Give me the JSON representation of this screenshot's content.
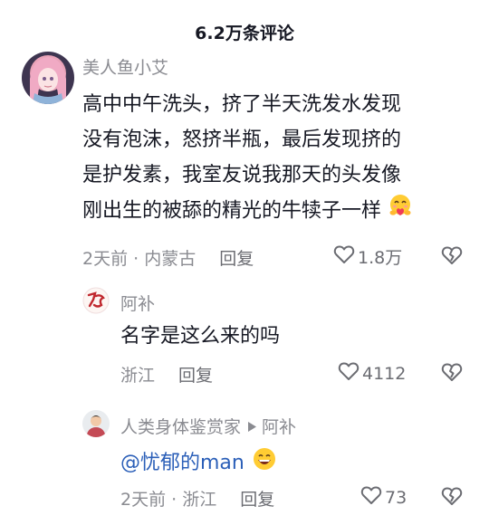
{
  "header": {
    "title": "6.2万条评论"
  },
  "comments": [
    {
      "username": "美人鱼小艾",
      "lines": [
        "高中中午洗头，挤了半天洗发水发现",
        "没有泡沫，怒挤半瓶，最后发现挤的",
        "是护发素，我室友说我那天的头发像",
        "刚出生的被舔的精光的牛犊子一样"
      ],
      "emoji": "heart-hug-emoji",
      "time_location": "2天前 · 内蒙古",
      "reply_label": "回复",
      "likes": "1.8万"
    }
  ],
  "replies": [
    {
      "username": "阿补",
      "text": "名字是这么来的吗",
      "time_location": "浙江",
      "reply_label": "回复",
      "likes": "4112"
    },
    {
      "username": "人类身体鉴赏家",
      "reply_to": "阿补",
      "mention": "@忧郁的man",
      "emoji": "grinning-emoji",
      "time_location": "2天前 · 浙江",
      "reply_label": "回复",
      "likes": "73"
    }
  ],
  "colors": {
    "secondary_text": "#8a8b91",
    "mention": "#2b5fb8",
    "primary_text": "#161823"
  }
}
